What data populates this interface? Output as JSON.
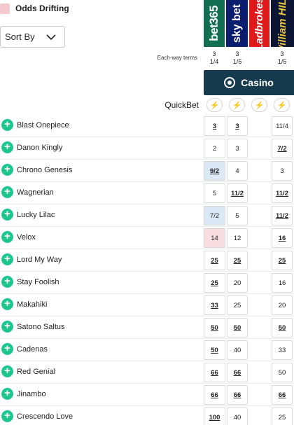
{
  "legend": {
    "label": "Odds Drifting",
    "swatch_color": "#f6c9cf"
  },
  "sort": {
    "label": "Sort By"
  },
  "bookmakers": [
    {
      "name": "bet365",
      "color": "#126e51"
    },
    {
      "name": "sky bet",
      "color": "#0a1d6e"
    },
    {
      "name": "Ladbrokes",
      "color": "#e01a1a"
    },
    {
      "name": "William HILL",
      "color": "#0d1534"
    }
  ],
  "each_way": {
    "label": "Each-way terms",
    "terms": [
      {
        "places": "3",
        "fraction": "1/4"
      },
      {
        "places": "3",
        "fraction": "1/5"
      },
      {
        "places": "",
        "fraction": ""
      },
      {
        "places": "3",
        "fraction": "1/5"
      }
    ]
  },
  "casino": {
    "label": "Casino"
  },
  "quickbet": {
    "label": "QuickBet"
  },
  "runners": [
    {
      "name": "Blast Onepiece",
      "odds": [
        "3",
        "3",
        "11/4"
      ],
      "ul": [
        true,
        true,
        false
      ],
      "hl": ""
    },
    {
      "name": "Danon Kingly",
      "odds": [
        "2",
        "3",
        "7/2"
      ],
      "ul": [
        false,
        false,
        true
      ],
      "hl": ""
    },
    {
      "name": "Chrono Genesis",
      "odds": [
        "9/2",
        "4",
        "3"
      ],
      "ul": [
        true,
        false,
        false
      ],
      "hl": "blue"
    },
    {
      "name": "Wagnerian",
      "odds": [
        "5",
        "11/2",
        "11/2"
      ],
      "ul": [
        false,
        true,
        true
      ],
      "hl": ""
    },
    {
      "name": "Lucky Lilac",
      "odds": [
        "7/2",
        "5",
        "11/2"
      ],
      "ul": [
        false,
        false,
        true
      ],
      "hl": "blue"
    },
    {
      "name": "Velox",
      "odds": [
        "14",
        "12",
        "16"
      ],
      "ul": [
        false,
        false,
        true
      ],
      "hl": "pink"
    },
    {
      "name": "Lord My Way",
      "odds": [
        "25",
        "25",
        "25"
      ],
      "ul": [
        true,
        true,
        true
      ],
      "hl": ""
    },
    {
      "name": "Stay Foolish",
      "odds": [
        "25",
        "20",
        "16"
      ],
      "ul": [
        true,
        false,
        false
      ],
      "hl": ""
    },
    {
      "name": "Makahiki",
      "odds": [
        "33",
        "25",
        "20"
      ],
      "ul": [
        true,
        false,
        false
      ],
      "hl": ""
    },
    {
      "name": "Satono Saltus",
      "odds": [
        "50",
        "50",
        "50"
      ],
      "ul": [
        true,
        true,
        true
      ],
      "hl": ""
    },
    {
      "name": "Cadenas",
      "odds": [
        "50",
        "40",
        "33"
      ],
      "ul": [
        true,
        false,
        false
      ],
      "hl": ""
    },
    {
      "name": "Red Genial",
      "odds": [
        "66",
        "66",
        "50"
      ],
      "ul": [
        true,
        true,
        false
      ],
      "hl": ""
    },
    {
      "name": "Jinambo",
      "odds": [
        "66",
        "66",
        "66"
      ],
      "ul": [
        true,
        true,
        true
      ],
      "hl": ""
    },
    {
      "name": "Crescendo Love",
      "odds": [
        "100",
        "40",
        "25"
      ],
      "ul": [
        true,
        false,
        false
      ],
      "hl": ""
    }
  ]
}
